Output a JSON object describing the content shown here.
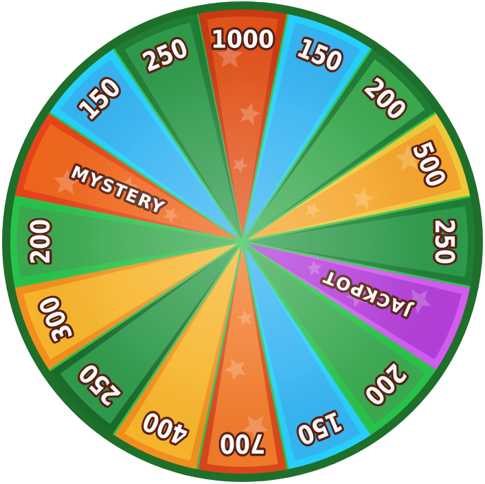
{
  "wheel": {
    "segments": [
      {
        "label": "1000",
        "color": "#e2531a",
        "edge": "#c93a12",
        "stars": true
      },
      {
        "label": "150",
        "color": "#35b4f2",
        "edge": "#27d0ff",
        "stars": false
      },
      {
        "label": "200",
        "color": "#3aa94f",
        "edge": "#1f7d35",
        "stars": false
      },
      {
        "label": "500",
        "color": "#f5a52a",
        "edge": "#f0c93a",
        "stars": true
      },
      {
        "label": "250",
        "color": "#2e9a4a",
        "edge": "#1f7d35",
        "stars": false
      },
      {
        "label": "JACKPOT",
        "color": "#b33fd9",
        "edge": "#d25cf0",
        "stars": true
      },
      {
        "label": "200",
        "color": "#3aa94f",
        "edge": "#28c24a",
        "stars": false
      },
      {
        "label": "150",
        "color": "#35b4f2",
        "edge": "#27d0ff",
        "stars": false
      },
      {
        "label": "700",
        "color": "#f07a2a",
        "edge": "#d9461a",
        "stars": true
      },
      {
        "label": "400",
        "color": "#f7b52b",
        "edge": "#f28f1e",
        "stars": false
      },
      {
        "label": "250",
        "color": "#2e9a4a",
        "edge": "#1a6b2c",
        "stars": false
      },
      {
        "label": "300",
        "color": "#f7b52b",
        "edge": "#f28f1e",
        "stars": false
      },
      {
        "label": "200",
        "color": "#3aa94f",
        "edge": "#28c24a",
        "stars": false
      },
      {
        "label": "MYSTERY",
        "color": "#f0661c",
        "edge": "#e8431a",
        "stars": true
      },
      {
        "label": "150",
        "color": "#35b4f2",
        "edge": "#27d0ff",
        "stars": false
      },
      {
        "label": "250",
        "color": "#2e9a4a",
        "edge": "#1f7d35",
        "stars": false
      }
    ],
    "divider_color": "#2fc24e",
    "outer_ring_color": "#1e6f2a"
  }
}
